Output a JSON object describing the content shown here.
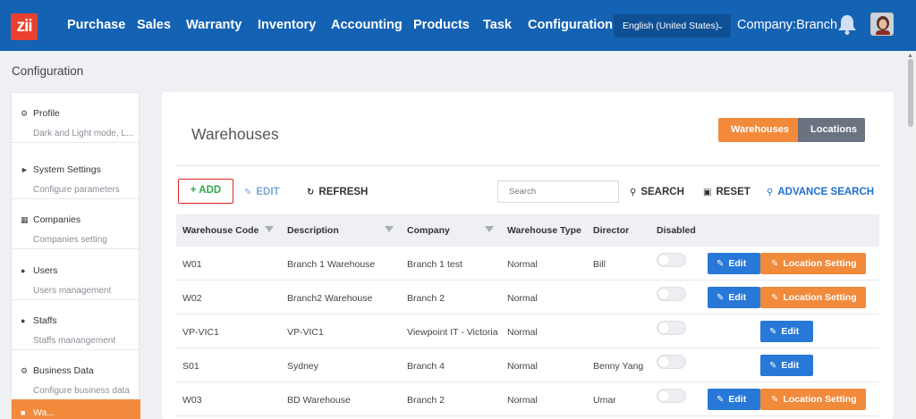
{
  "nav": {
    "logo": "zii",
    "items": [
      "Purchase",
      "Sales",
      "Warranty",
      "Inventory",
      "Accounting",
      "Products",
      "Task",
      "Configuration"
    ],
    "language": "English (United States)",
    "company": "Company:Branch 2"
  },
  "page": {
    "title": "Configuration"
  },
  "sidebar": {
    "items": [
      {
        "title": "Profile",
        "subtitle": "Dark and Light mode, L...",
        "icon": "gear-icon"
      },
      {
        "title": "System Settings",
        "subtitle": "Configure parameters",
        "icon": "tag-icon"
      },
      {
        "title": "Companies",
        "subtitle": "Companies setting",
        "icon": "building-icon"
      },
      {
        "title": "Users",
        "subtitle": "Users management",
        "icon": "users-icon"
      },
      {
        "title": "Staffs",
        "subtitle": "Staffs manangement",
        "icon": "users-icon"
      },
      {
        "title": "Business Data",
        "subtitle": "Configure business data",
        "icon": "gear-icon"
      },
      {
        "title": "Wa...",
        "subtitle": "",
        "icon": "warehouse-icon"
      }
    ]
  },
  "card": {
    "title": "Warehouses",
    "toggle": {
      "active": "Warehouses",
      "inactive": "Locations"
    },
    "toolbar": {
      "add": "ADD",
      "edit": "EDIT",
      "refresh": "REFRESH",
      "search_placeholder": "Search",
      "search": "SEARCH",
      "reset": "RESET",
      "advance_search": "ADVANCE SEARCH"
    }
  },
  "table": {
    "columns": [
      "Warehouse Code",
      "Description",
      "Company",
      "Warehouse Type",
      "Director",
      "Disabled"
    ],
    "edit_label": "Edit",
    "location_label": "Location Setting",
    "rows": [
      {
        "code": "W01",
        "description": "Branch 1 Warehouse",
        "company": "Branch 1 test",
        "type": "Normal",
        "director": "Bill",
        "disabled": false,
        "has_location": true
      },
      {
        "code": "W02",
        "description": "Branch2 Warehouse",
        "company": "Branch 2",
        "type": "Normal",
        "director": "",
        "disabled": false,
        "has_location": true
      },
      {
        "code": "VP-VIC1",
        "description": "VP-VIC1",
        "company": "Viewpoint IT - Victoria",
        "type": "Normal",
        "director": "",
        "disabled": false,
        "has_location": false
      },
      {
        "code": "S01",
        "description": "Sydney",
        "company": "Branch 4",
        "type": "Normal",
        "director": "Benny Yang",
        "disabled": false,
        "has_location": false
      },
      {
        "code": "W03",
        "description": "BD Warehouse",
        "company": "Branch 2",
        "type": "Normal",
        "director": "Umar",
        "disabled": false,
        "has_location": true
      }
    ]
  },
  "colors": {
    "nav_bg": "#1462b4",
    "accent_orange": "#f28a3c",
    "primary_blue": "#2878d8",
    "add_green": "#2fa84f",
    "add_border_red": "#e02424"
  }
}
